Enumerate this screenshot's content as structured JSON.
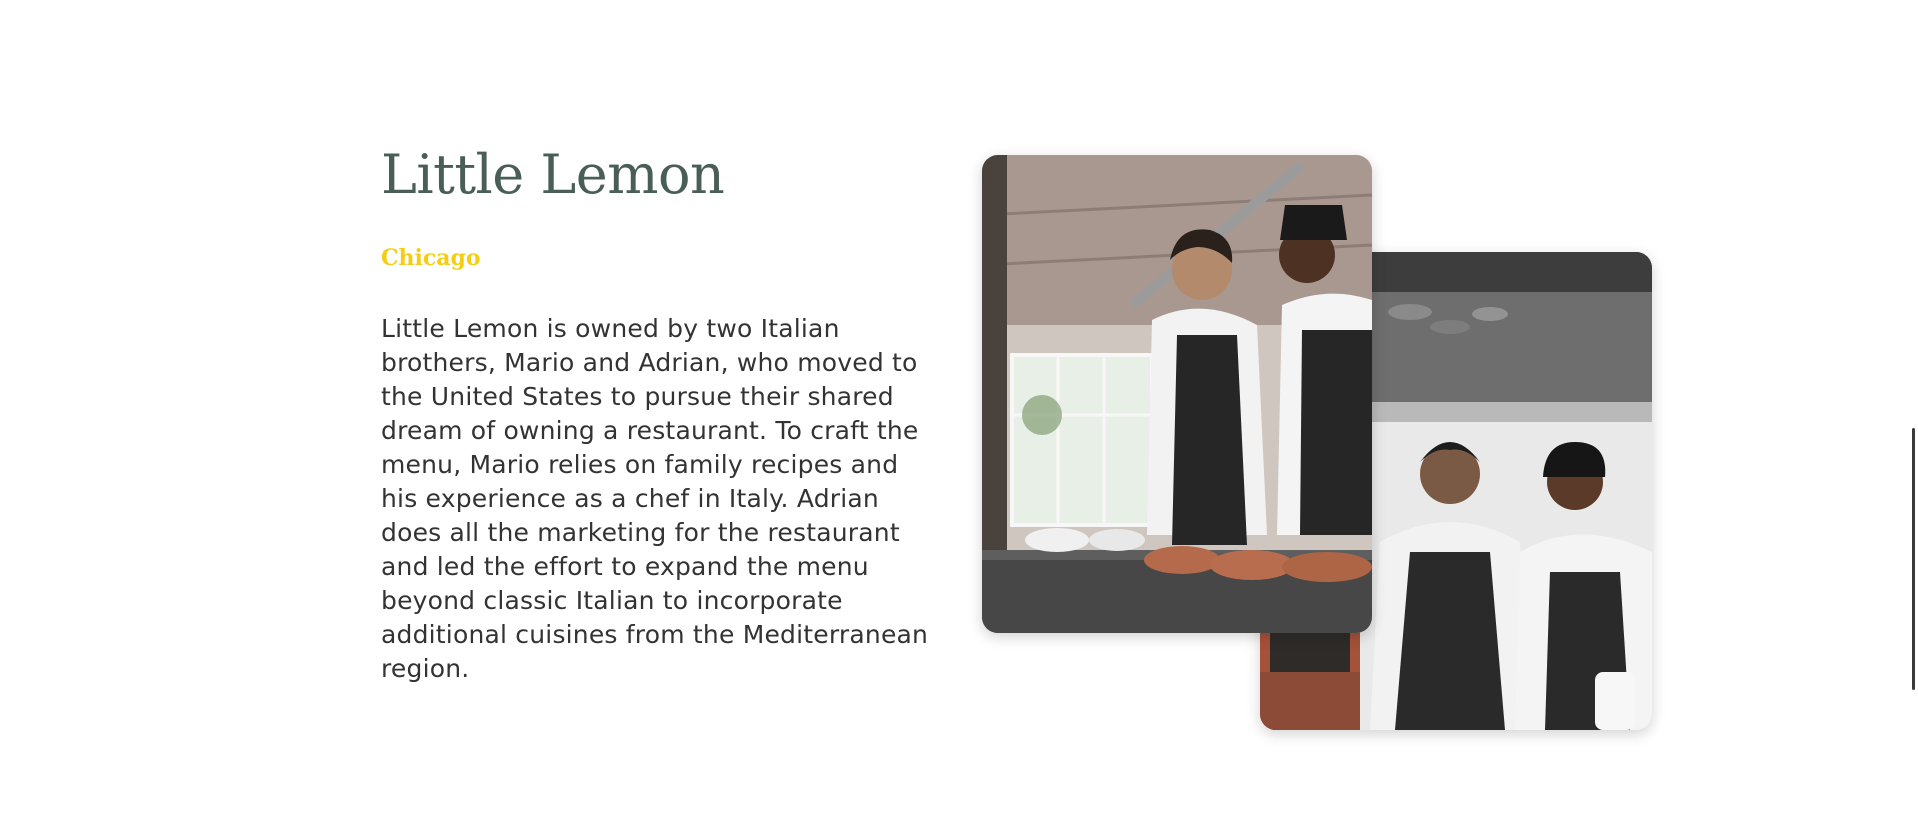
{
  "about": {
    "title": "Little Lemon",
    "subtitle": "Chicago",
    "description": "Little Lemon is owned by two Italian brothers, Mario and Adrian, who moved to the United States to pursue their shared dream of owning a restaurant. To craft the menu, Mario relies on family recipes and his experience as a chef in Italy. Adrian does all the marketing for the restaurant and led the effort to expand the menu beyond classic Italian to incorporate additional cuisines from the Mediterranean region."
  },
  "colors": {
    "primary_green": "#495E57",
    "accent_yellow": "#F4CE14",
    "text": "#333333"
  }
}
